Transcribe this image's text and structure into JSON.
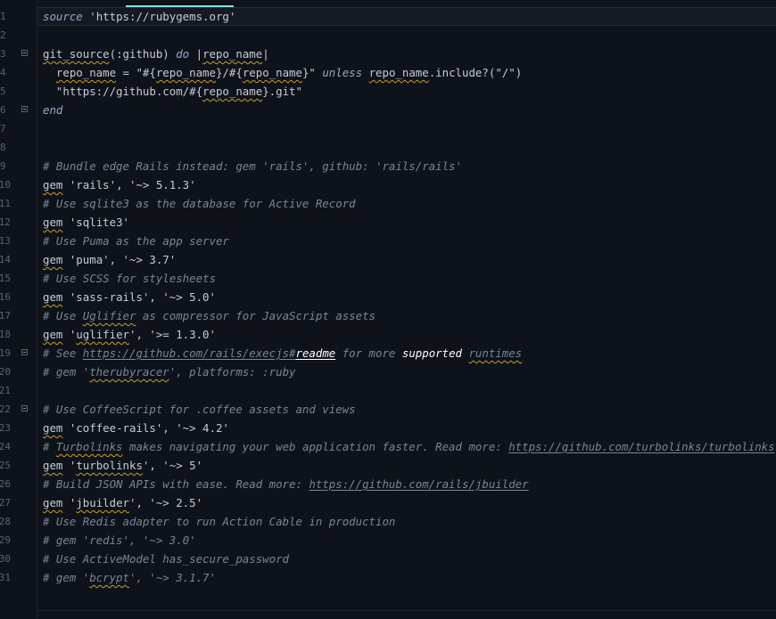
{
  "editor": {
    "lines": [
      {
        "n": "1",
        "fold": false,
        "indent": "",
        "tokens": [
          {
            "t": "source",
            "c": "kw"
          },
          {
            "t": " "
          },
          {
            "t": "'https://rubygems.org'",
            "c": "str"
          }
        ]
      },
      {
        "n": "2",
        "fold": false,
        "indent": "",
        "tokens": []
      },
      {
        "n": "3",
        "fold": true,
        "indent": "",
        "tokens": [
          {
            "t": "git_source",
            "c": "squig"
          },
          {
            "t": "(:github) "
          },
          {
            "t": "do",
            "c": "kw"
          },
          {
            "t": " |"
          },
          {
            "t": "repo_name",
            "c": "squig"
          },
          {
            "t": "|"
          }
        ]
      },
      {
        "n": "4",
        "fold": false,
        "indent": "  ",
        "tokens": [
          {
            "t": "repo_name",
            "c": "squig"
          },
          {
            "t": " = \"#{"
          },
          {
            "t": "repo_name",
            "c": "squig"
          },
          {
            "t": "}/#{"
          },
          {
            "t": "repo_name",
            "c": "squig"
          },
          {
            "t": "}\" "
          },
          {
            "t": "unless",
            "c": "kw"
          },
          {
            "t": " "
          },
          {
            "t": "repo_name",
            "c": "squig"
          },
          {
            "t": ".include?(\"/\")"
          }
        ]
      },
      {
        "n": "5",
        "fold": false,
        "indent": "  ",
        "tokens": [
          {
            "t": "\"https://github.com/#{"
          },
          {
            "t": "repo_name",
            "c": "squig"
          },
          {
            "t": "}.git\""
          }
        ]
      },
      {
        "n": "6",
        "fold": true,
        "indent": "",
        "tokens": [
          {
            "t": "end",
            "c": "kw"
          }
        ]
      },
      {
        "n": "7",
        "fold": false,
        "indent": "",
        "tokens": []
      },
      {
        "n": "8",
        "fold": false,
        "indent": "",
        "tokens": []
      },
      {
        "n": "9",
        "fold": false,
        "indent": "",
        "tokens": [
          {
            "t": "# Bundle edge Rails instead: gem 'rails', github: 'rails/rails'",
            "c": "cm"
          }
        ]
      },
      {
        "n": "10",
        "fold": false,
        "indent": "",
        "tokens": [
          {
            "t": "gem",
            "c": "squig"
          },
          {
            "t": " 'rails', '~> 5.1.3'"
          }
        ]
      },
      {
        "n": "11",
        "fold": false,
        "indent": "",
        "tokens": [
          {
            "t": "# Use sqlite3 as the database for Active Record",
            "c": "cm"
          }
        ]
      },
      {
        "n": "12",
        "fold": false,
        "indent": "",
        "tokens": [
          {
            "t": "gem",
            "c": "squig"
          },
          {
            "t": " 'sqlite3'"
          }
        ]
      },
      {
        "n": "13",
        "fold": false,
        "indent": "",
        "tokens": [
          {
            "t": "# Use Puma as the app server",
            "c": "cm"
          }
        ]
      },
      {
        "n": "14",
        "fold": false,
        "indent": "",
        "tokens": [
          {
            "t": "gem",
            "c": "squig"
          },
          {
            "t": " 'puma', '~> 3.7'"
          }
        ]
      },
      {
        "n": "15",
        "fold": false,
        "indent": "",
        "tokens": [
          {
            "t": "# Use SCSS for stylesheets",
            "c": "cm"
          }
        ]
      },
      {
        "n": "16",
        "fold": false,
        "indent": "",
        "tokens": [
          {
            "t": "gem",
            "c": "squig"
          },
          {
            "t": " 'sass-rails', '~> 5.0'"
          }
        ]
      },
      {
        "n": "17",
        "fold": false,
        "indent": "",
        "tokens": [
          {
            "t": "# Use ",
            "c": "cm"
          },
          {
            "t": "Uglifier",
            "c": "cm squig"
          },
          {
            "t": " as compressor for JavaScript assets",
            "c": "cm"
          }
        ]
      },
      {
        "n": "18",
        "fold": false,
        "indent": "",
        "tokens": [
          {
            "t": "gem",
            "c": "squig"
          },
          {
            "t": " '"
          },
          {
            "t": "uglifier",
            "c": "squig"
          },
          {
            "t": "', '>= 1.3.0'"
          }
        ]
      },
      {
        "n": "19",
        "fold": true,
        "indent": "",
        "tokens": [
          {
            "t": "# See ",
            "c": "cm"
          },
          {
            "t": "https://github.com/rails/execjs#",
            "c": "cm link"
          },
          {
            "t": "readme",
            "c": "hi link"
          },
          {
            "t": " for more ",
            "c": "cm"
          },
          {
            "t": "supported",
            "c": "hi"
          },
          {
            "t": " ",
            "c": "cm"
          },
          {
            "t": "runtimes",
            "c": "cm squig"
          }
        ]
      },
      {
        "n": "20",
        "fold": false,
        "indent": "",
        "tokens": [
          {
            "t": "# gem '",
            "c": "cm"
          },
          {
            "t": "therubyracer",
            "c": "cm squig"
          },
          {
            "t": "', platforms: :ruby",
            "c": "cm"
          }
        ]
      },
      {
        "n": "21",
        "fold": false,
        "indent": "",
        "tokens": []
      },
      {
        "n": "22",
        "fold": true,
        "indent": "",
        "tokens": [
          {
            "t": "# Use CoffeeScript for .coffee assets and views",
            "c": "cm"
          }
        ]
      },
      {
        "n": "23",
        "fold": false,
        "indent": "",
        "tokens": [
          {
            "t": "gem",
            "c": "squig"
          },
          {
            "t": " 'coffee-rails', '~> 4.2'"
          }
        ]
      },
      {
        "n": "24",
        "fold": false,
        "indent": "",
        "tokens": [
          {
            "t": "# ",
            "c": "cm"
          },
          {
            "t": "Turbolinks",
            "c": "cm squig"
          },
          {
            "t": " makes navigating your web application faster. Read more: ",
            "c": "cm"
          },
          {
            "t": "https://github.com/turbolinks/turbolinks",
            "c": "cm link"
          }
        ]
      },
      {
        "n": "25",
        "fold": false,
        "indent": "",
        "tokens": [
          {
            "t": "gem",
            "c": "squig"
          },
          {
            "t": " '"
          },
          {
            "t": "turbolinks",
            "c": "squig"
          },
          {
            "t": "', '~> 5'"
          }
        ]
      },
      {
        "n": "26",
        "fold": false,
        "indent": "",
        "tokens": [
          {
            "t": "# Build JSON APIs with ease. Read more: ",
            "c": "cm"
          },
          {
            "t": "https://github.com/rails/jbuilder",
            "c": "cm link"
          }
        ]
      },
      {
        "n": "27",
        "fold": false,
        "indent": "",
        "tokens": [
          {
            "t": "gem",
            "c": "squig"
          },
          {
            "t": " '"
          },
          {
            "t": "jbuilder",
            "c": "squig"
          },
          {
            "t": "', '~> 2.5'"
          }
        ]
      },
      {
        "n": "28",
        "fold": false,
        "indent": "",
        "tokens": [
          {
            "t": "# Use Redis adapter to run Action Cable in production",
            "c": "cm"
          }
        ]
      },
      {
        "n": "29",
        "fold": false,
        "indent": "",
        "tokens": [
          {
            "t": "# gem 'redis', '~> 3.0'",
            "c": "cm"
          }
        ]
      },
      {
        "n": "30",
        "fold": false,
        "indent": "",
        "tokens": [
          {
            "t": "# Use ActiveModel has_secure_password",
            "c": "cm"
          }
        ]
      },
      {
        "n": "31",
        "fold": false,
        "indent": "",
        "tokens": [
          {
            "t": "# gem '",
            "c": "cm"
          },
          {
            "t": "bcrypt",
            "c": "cm squig"
          },
          {
            "t": "', '~> 3.1.7'",
            "c": "cm"
          }
        ]
      }
    ]
  },
  "colors": {
    "background": "#0e121a",
    "text": "#c6ccd6",
    "comment": "#7a8597",
    "keyword": "#9ba7c9",
    "tab_accent": "#7fe3e6",
    "spellcheck": "#c9a02a"
  }
}
